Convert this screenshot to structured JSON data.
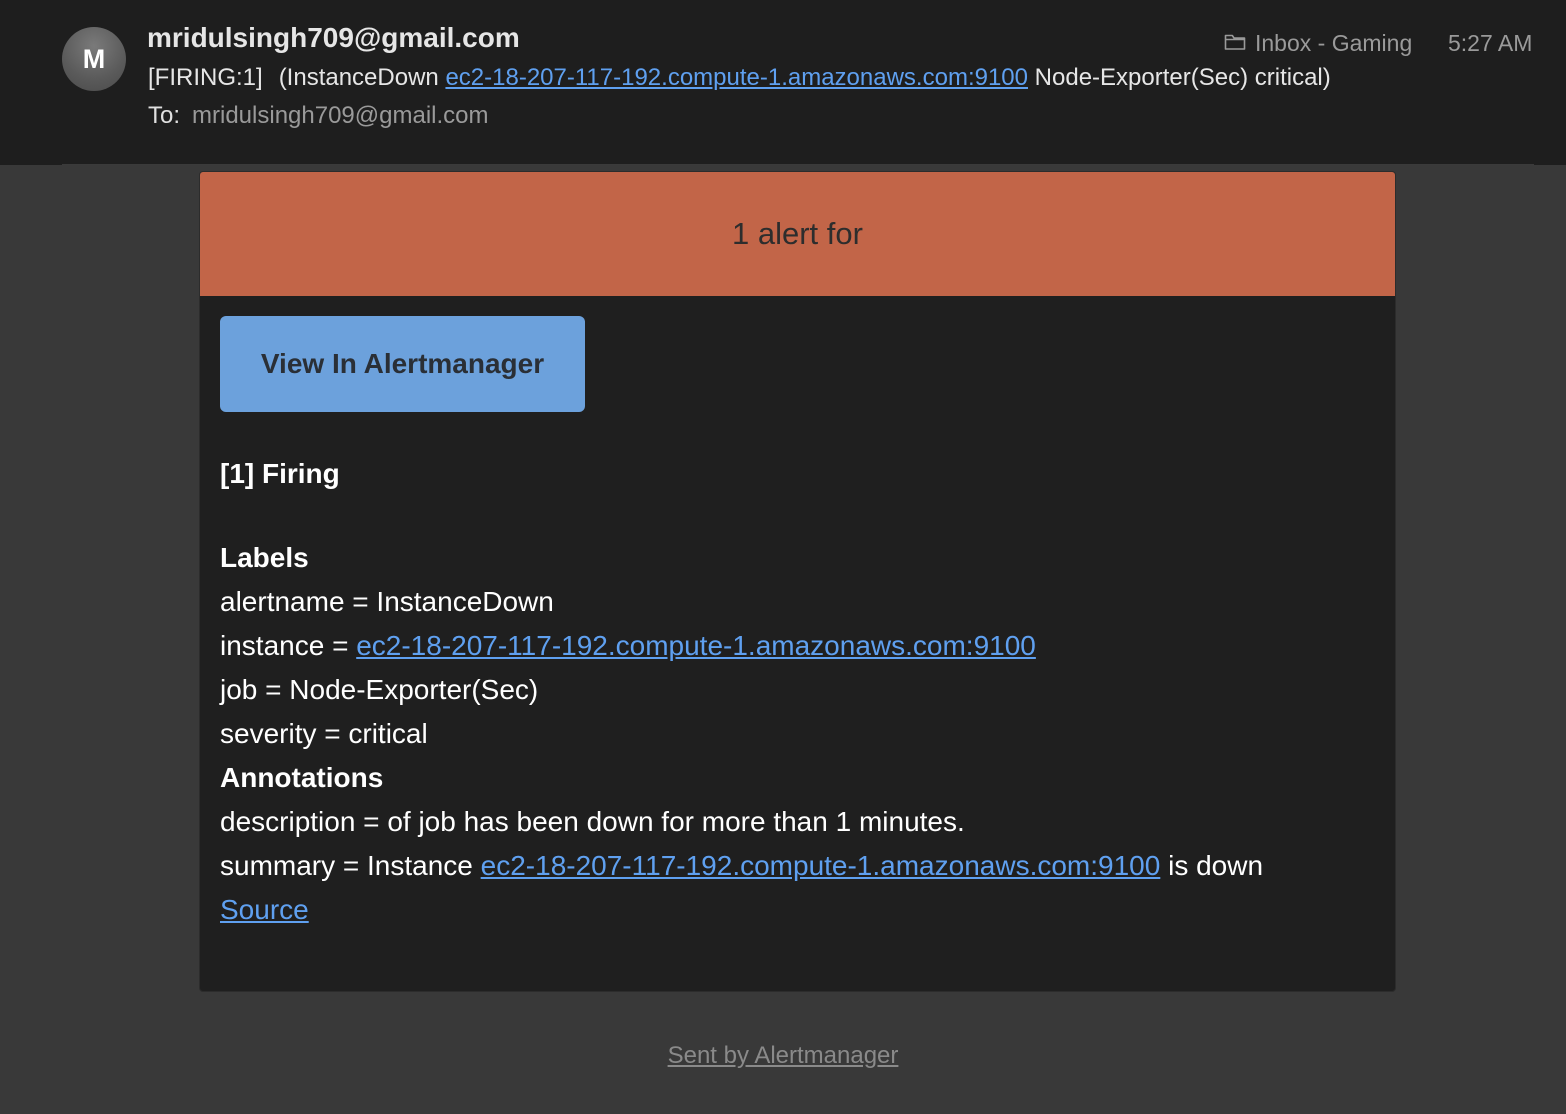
{
  "header": {
    "avatar_initial": "M",
    "sender": "mridulsingh709@gmail.com",
    "folder_icon": "folder-icon",
    "folder": "Inbox - Gaming",
    "time": "5:27 AM",
    "subject": {
      "prefix": "[FIRING:1]",
      "part1": "(InstanceDown",
      "link": "ec2-18-207-117-192.compute-1.amazonaws.com:9100",
      "part2": "Node-Exporter(Sec) critical)"
    },
    "to_label": "To:",
    "to_value": "mridulsingh709@gmail.com"
  },
  "email": {
    "banner_title": "1 alert for",
    "view_button": "View In Alertmanager",
    "firing_heading": "[1] Firing",
    "labels_heading": "Labels",
    "labels": {
      "alertname": "alertname = InstanceDown",
      "instance_prefix": "instance = ",
      "instance_link": "ec2-18-207-117-192.compute-1.amazonaws.com:9100",
      "job": "job = Node-Exporter(Sec)",
      "severity": "severity = critical"
    },
    "annotations_heading": "Annotations",
    "annotations": {
      "description": "description = of job has been down for more than 1 minutes.",
      "summary_prefix": "summary = Instance ",
      "summary_link": "ec2-18-207-117-192.compute-1.amazonaws.com:9100",
      "summary_suffix": " is down"
    },
    "source_link": "Source"
  },
  "footer": {
    "sent_by": "Sent by Alertmanager"
  },
  "colors": {
    "banner": "#c26548",
    "button": "#6ca1dc",
    "link": "#5fa0f0"
  }
}
